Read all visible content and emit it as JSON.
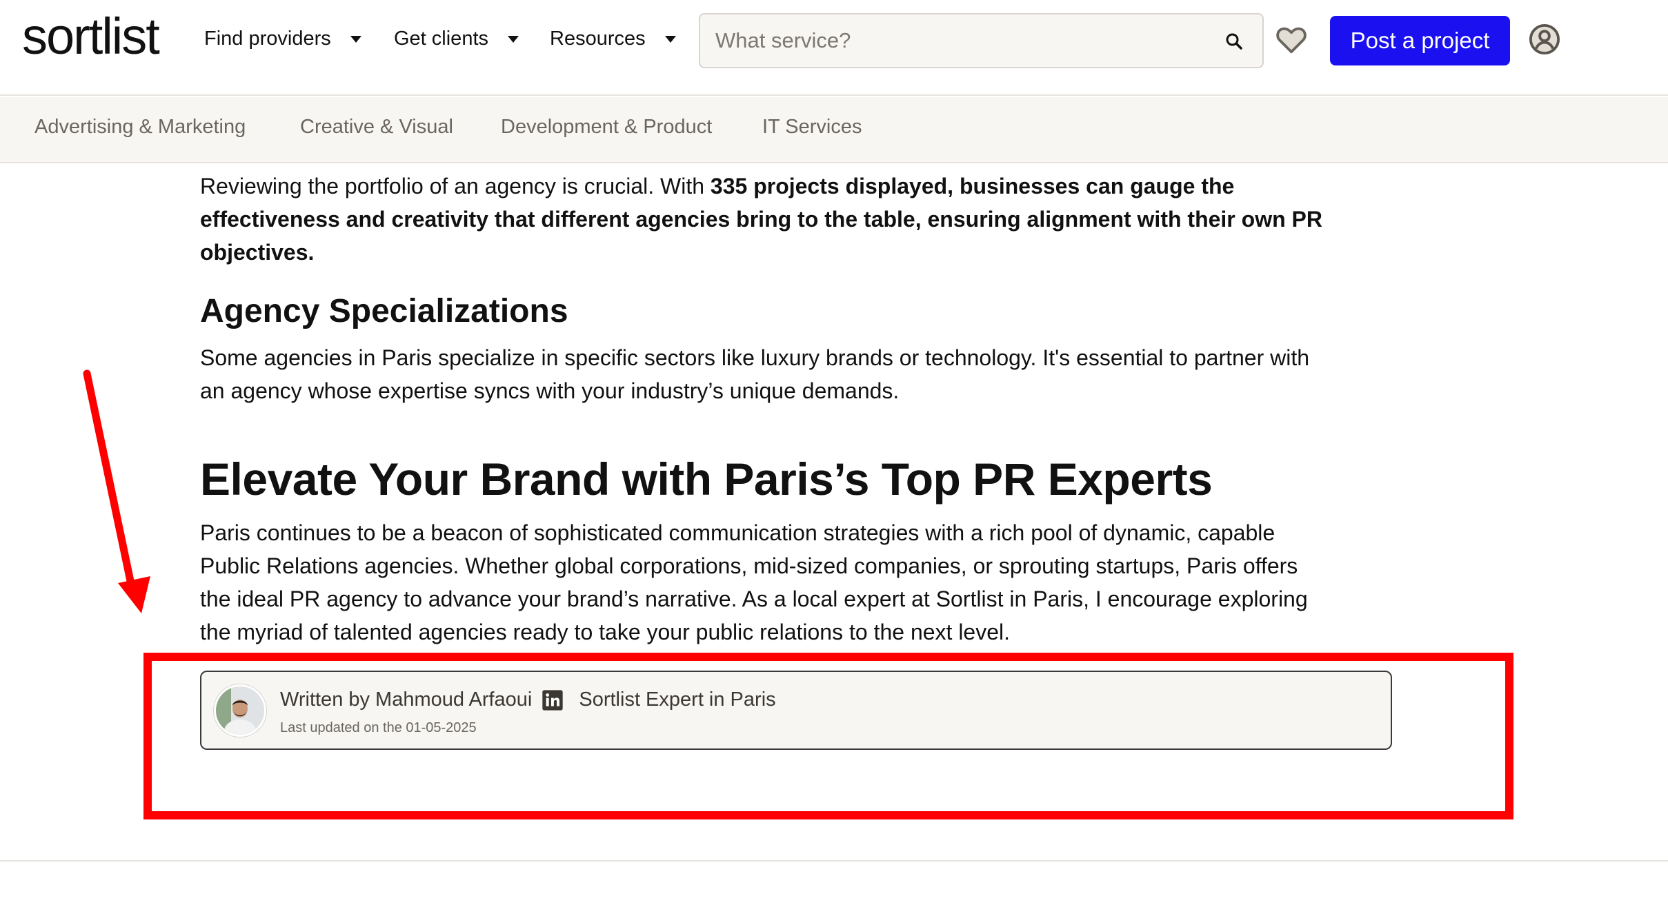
{
  "header": {
    "logo": "sortlist",
    "nav": [
      {
        "label": "Find providers"
      },
      {
        "label": "Get clients"
      },
      {
        "label": "Resources"
      }
    ],
    "search_placeholder": "What service?",
    "post_button": "Post a project",
    "accent_color": "#1a10f0"
  },
  "categories": [
    {
      "label": "Advertising & Marketing"
    },
    {
      "label": "Creative & Visual"
    },
    {
      "label": "Development & Product"
    },
    {
      "label": "IT Services"
    }
  ],
  "article": {
    "portfolio_para": {
      "lead": "Reviewing the portfolio of an agency is crucial. With ",
      "bold_line1": "335 projects displayed, businesses can gauge the",
      "bold_line2": "effectiveness and creativity that different agencies bring to the table, ensuring alignment with their own PR",
      "bold_line3": "objectives."
    },
    "specializations": {
      "heading": "Agency Specializations",
      "line1": "Some agencies in Paris specialize in specific sectors like luxury brands or technology. It's essential to partner with",
      "line2": "an agency whose expertise syncs with your industry’s unique demands."
    },
    "elevate": {
      "heading": "Elevate Your Brand with Paris’s Top PR Experts",
      "line1": "Paris continues to be a beacon of sophisticated communication strategies with a rich pool of dynamic, capable",
      "line2": "Public Relations agencies. Whether global corporations, mid-sized companies, or sprouting startups, Paris offers",
      "line3": "the ideal PR agency to advance your brand’s narrative. As a local expert at Sortlist in Paris, I encourage exploring",
      "line4": "the myriad of talented agencies ready to take your public relations to the next level."
    }
  },
  "author": {
    "written_by": "Written by Mahmoud Arfaoui",
    "role": "Sortlist Expert in Paris",
    "updated": "Last updated on the 01-05-2025",
    "linkedin_icon": "linkedin-icon"
  },
  "annotation": {
    "color": "#ff0000"
  }
}
